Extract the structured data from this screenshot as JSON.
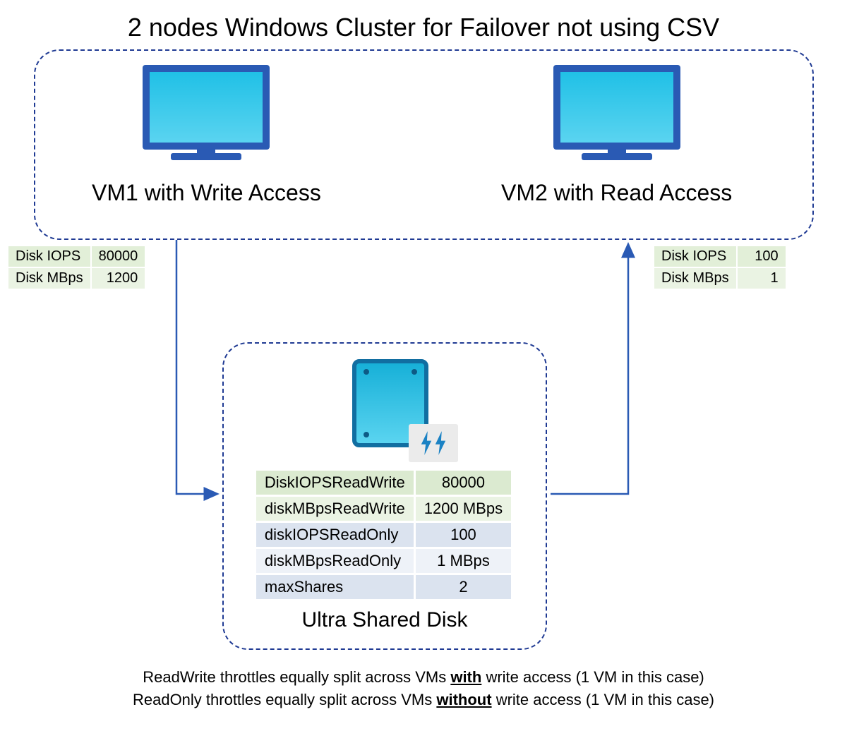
{
  "title": "2 nodes Windows Cluster for Failover not using CSV",
  "vm1": {
    "label": "VM1 with Write Access",
    "iopsLabel": "Disk IOPS",
    "iopsValue": "80000",
    "mbpsLabel": "Disk MBps",
    "mbpsValue": "1200"
  },
  "vm2": {
    "label": "VM2 with Read Access",
    "iopsLabel": "Disk IOPS",
    "iopsValue": "100",
    "mbpsLabel": "Disk MBps",
    "mbpsValue": "1"
  },
  "disk": {
    "label": "Ultra Shared Disk",
    "rows": [
      {
        "key": "DiskIOPSReadWrite",
        "val": "80000"
      },
      {
        "key": "diskMBpsReadWrite",
        "val": "1200 MBps"
      },
      {
        "key": "diskIOPSReadOnly",
        "val": "100"
      },
      {
        "key": "diskMBpsReadOnly",
        "val": "1 MBps"
      },
      {
        "key": "maxShares",
        "val": "2"
      }
    ]
  },
  "notes": {
    "line1a": "ReadWrite throttles equally split across VMs ",
    "line1b": "with",
    "line1c": " write access (1 VM in this case)",
    "line2a": "ReadOnly throttles equally split across VMs ",
    "line2b": "without",
    "line2c": " write access (1 VM in this case)"
  }
}
